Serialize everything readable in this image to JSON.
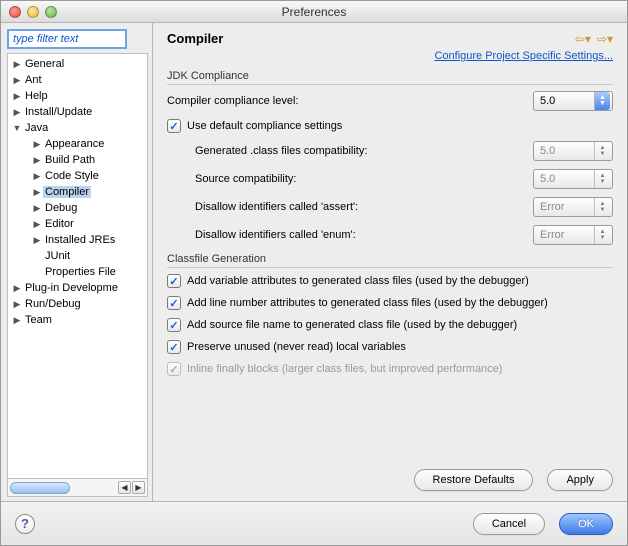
{
  "window": {
    "title": "Preferences"
  },
  "filter": {
    "placeholder": "type filter text"
  },
  "tree": {
    "general": "General",
    "ant": "Ant",
    "help": "Help",
    "install": "Install/Update",
    "java": "Java",
    "java_children": {
      "appearance": "Appearance",
      "buildpath": "Build Path",
      "codestyle": "Code Style",
      "compiler": "Compiler",
      "debug": "Debug",
      "editor": "Editor",
      "jres": "Installed JREs",
      "junit": "JUnit",
      "props": "Properties File"
    },
    "plugin": "Plug-in Developme",
    "rundebug": "Run/Debug",
    "team": "Team"
  },
  "page": {
    "title": "Compiler",
    "link": "Configure Project Specific Settings..."
  },
  "jdk": {
    "group": "JDK Compliance",
    "compliance_label": "Compiler compliance level:",
    "compliance_value": "5.0",
    "use_default": "Use default compliance settings",
    "gen_class_label": "Generated .class files compatibility:",
    "gen_class_value": "5.0",
    "source_label": "Source compatibility:",
    "source_value": "5.0",
    "assert_label": "Disallow identifiers called 'assert':",
    "assert_value": "Error",
    "enum_label": "Disallow identifiers called 'enum':",
    "enum_value": "Error"
  },
  "classfile": {
    "group": "Classfile Generation",
    "c1": "Add variable attributes to generated class files (used by the debugger)",
    "c2": "Add line number attributes to generated class files (used by the debugger)",
    "c3": "Add source file name to generated class file (used by the debugger)",
    "c4": "Preserve unused (never read) local variables",
    "c5": "Inline finally blocks (larger class files, but improved performance)"
  },
  "buttons": {
    "restore": "Restore Defaults",
    "apply": "Apply",
    "cancel": "Cancel",
    "ok": "OK"
  }
}
